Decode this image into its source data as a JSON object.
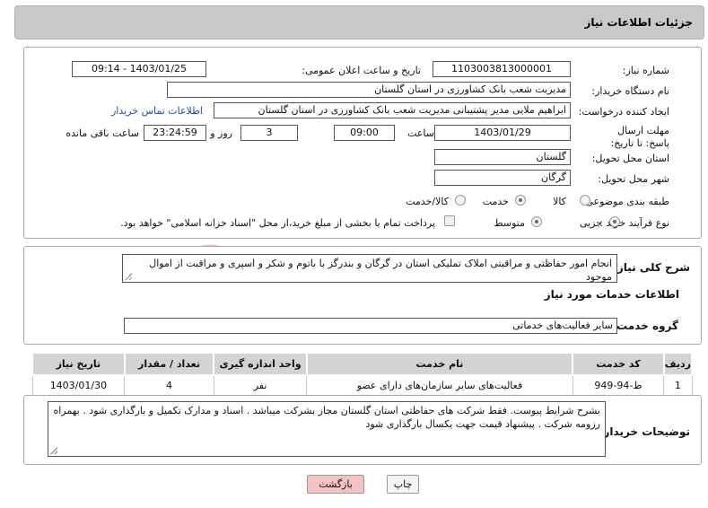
{
  "page": {
    "title": "جزئیات اطلاعات نیاز"
  },
  "form": {
    "need_number_label": "شماره نیاز:",
    "need_number": "1103003813000001",
    "announce_label": "تاریخ و ساعت اعلان عمومی:",
    "announce_value": "1403/01/25 - 09:14",
    "buyer_org_label": "نام دستگاه خریدار:",
    "buyer_org": "مدیریت شعب بانک کشاورزی در استان گلستان",
    "creator_label": "ایجاد کننده درخواست:",
    "creator": "ابراهیم ملایی  مدیر پشتیبانی مدیریت شعب بانک کشاورزی در استان گلستان",
    "buyer_contact_link": "اطلاعات تماس خریدار",
    "deadline_label": "مهلت ارسال پاسخ: تا تاریخ:",
    "deadline_date": "1403/01/29",
    "hour_label": "ساعت",
    "deadline_time": "09:00",
    "days_value": "3",
    "days_label": "روز و",
    "remaining_value": "23:24:59",
    "remaining_label": "ساعت باقی مانده",
    "province_label": "استان محل تحویل:",
    "province": "گلستان",
    "city_label": "شهر محل تحویل:",
    "city": "گرگان",
    "category_label": "طبقه بندی موضوعی:",
    "category_options": [
      "کالا",
      "خدمت",
      "کالا/خدمت"
    ],
    "category_selected": "خدمت",
    "process_label": "نوع فرآیند خرید :",
    "process_options": [
      "جزیی",
      "متوسط"
    ],
    "process_selected": "جزیی",
    "payment_note": "پرداخت تمام یا بخشی از مبلغ خرید،از محل \"اسناد خزانه اسلامی\" خواهد بود."
  },
  "summary": {
    "label": "شرح کلی نیاز:",
    "text": "انجام امور حفاظتی و مراقبتی املاک تملیکی استان در گرگان و بندرگز با باتوم و شکر و اسپری و مراقبت از اموال موجود"
  },
  "services": {
    "section_title": "اطلاعات خدمات مورد نیاز",
    "group_label": "گروه خدمت:",
    "group_value": "سایر فعالیت‌های خدماتی",
    "columns": [
      "ردیف",
      "کد خدمت",
      "نام خدمت",
      "واحد اندازه گیری",
      "تعداد / مقدار",
      "تاریخ نیاز"
    ],
    "rows": [
      [
        "1",
        "ط-94-949",
        "فعالیت‌های سایر سازمان‌های دارای عضو",
        "نفر",
        "4",
        "1403/01/30"
      ]
    ]
  },
  "buyer_notes": {
    "label": "توضیحات خریدار:",
    "text": "بشرح شرایط پیوست. فقط شرکت های حفاظتی استان گلستان مجاز بشرکت میباشد . اسناد و مدارک تکمیل و بارگذاری شود . بهمراه رزومه شرکت . پیشنهاد قیمت جهت یکسال بارگذاری شود"
  },
  "buttons": {
    "print": "چاپ",
    "back": "بازگشت"
  },
  "watermark": {
    "text": "AriaTender.net"
  },
  "colors": {
    "link": "#1a4fb5",
    "watermark": "#e9b7b7",
    "header_bg": "#c9c9c9",
    "back_button_bg": "#f3c2c2"
  }
}
